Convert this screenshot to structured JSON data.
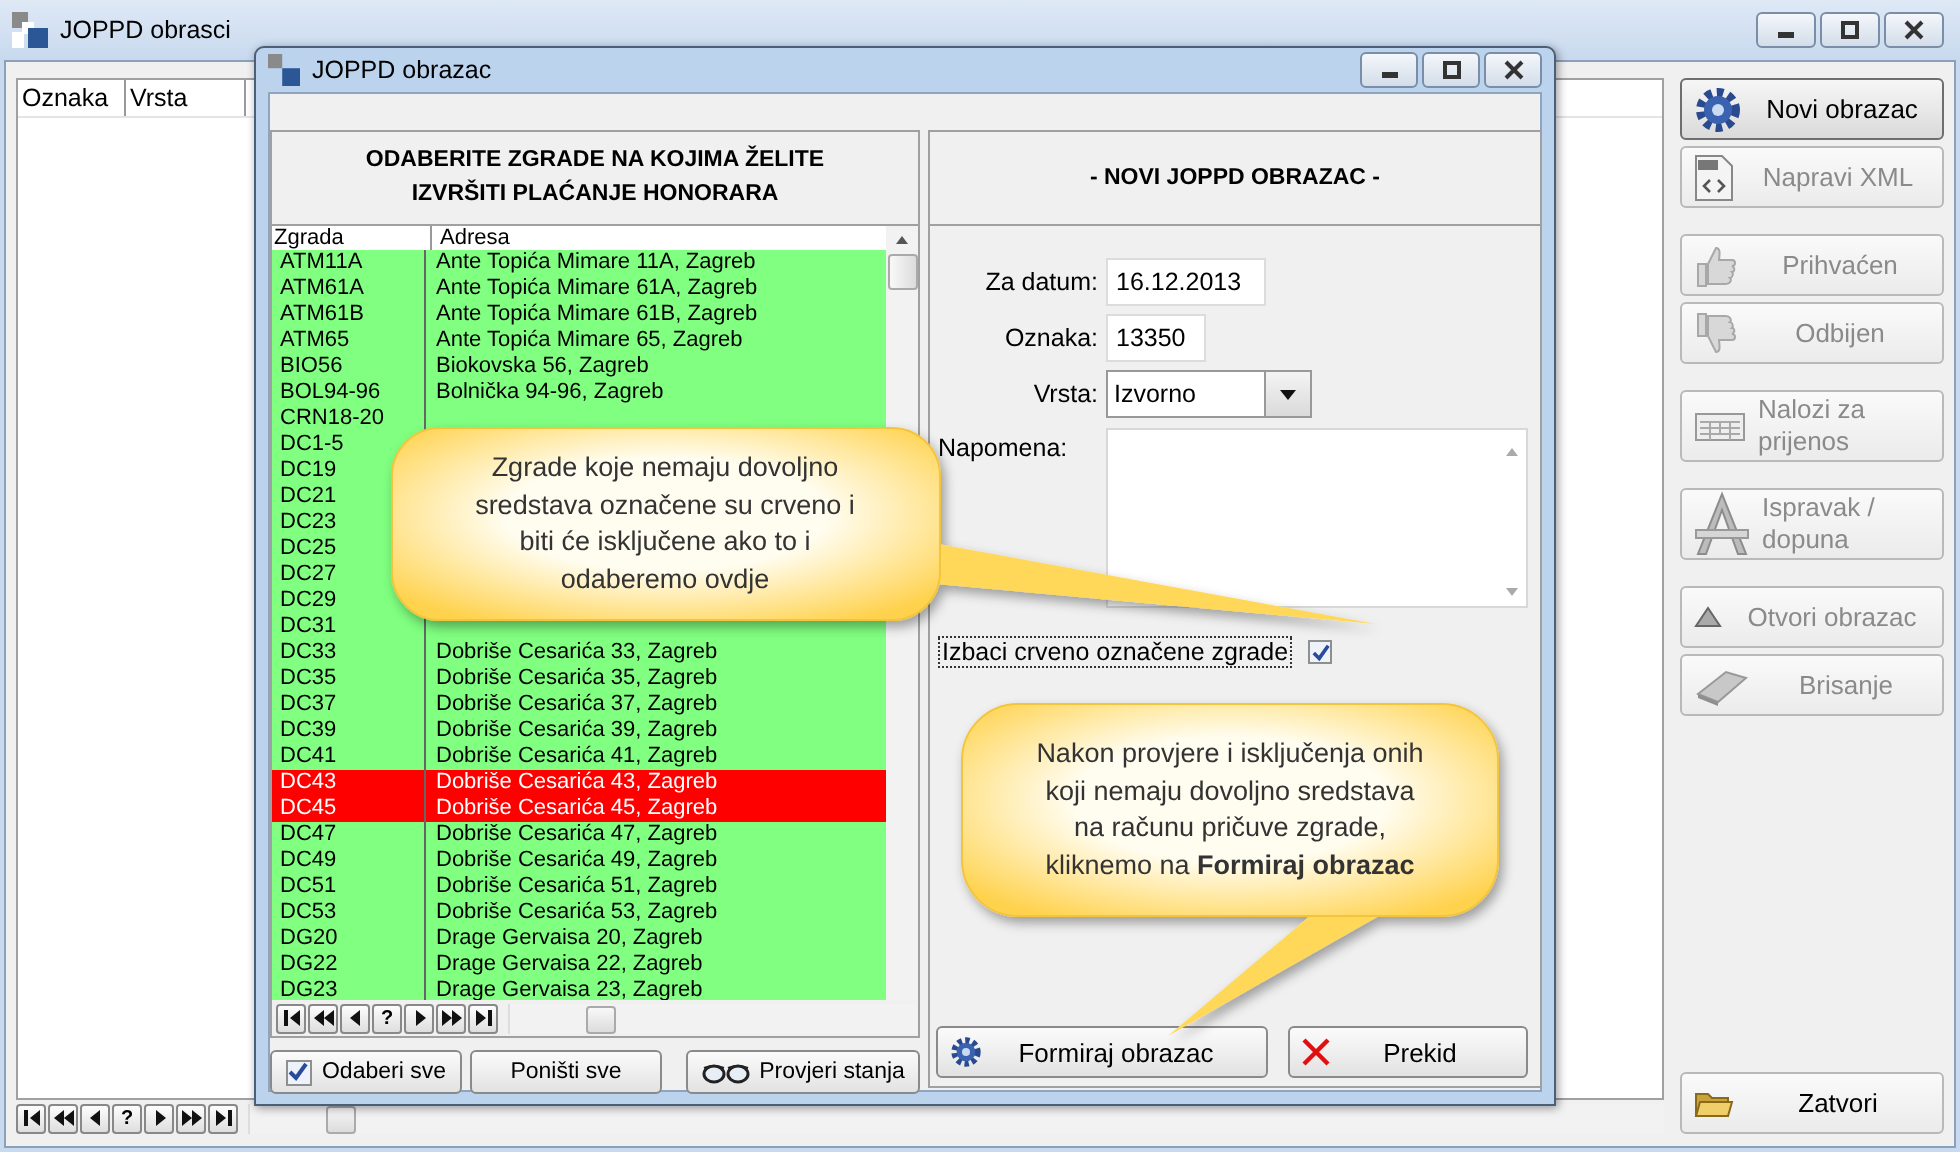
{
  "window": {
    "title": "JOPPD obrasci"
  },
  "main_table": {
    "columns": [
      "Oznaka",
      "Vrsta"
    ]
  },
  "main_navigator": [
    {
      "kind": "first"
    },
    {
      "kind": "prev-page"
    },
    {
      "kind": "prev"
    },
    {
      "kind": "help",
      "label": "?"
    },
    {
      "kind": "next"
    },
    {
      "kind": "next-page"
    },
    {
      "kind": "last"
    }
  ],
  "sidebar": {
    "groups": [
      [
        {
          "kind": "new",
          "label": "Novi obrazac",
          "disabled": false
        },
        {
          "kind": "xml",
          "label": "Napravi XML",
          "disabled": true
        }
      ],
      [
        {
          "kind": "accept",
          "label": "Prihvaćen",
          "disabled": true
        },
        {
          "kind": "reject",
          "label": "Odbijen",
          "disabled": true
        }
      ],
      [
        {
          "kind": "transfer",
          "label": "Nalozi za prijenos",
          "disabled": true
        }
      ],
      [
        {
          "kind": "correction",
          "label": "Ispravak / dopuna",
          "disabled": true
        }
      ],
      [
        {
          "kind": "open",
          "label": "Otvori obrazac",
          "disabled": true
        },
        {
          "kind": "delete",
          "label": "Brisanje",
          "disabled": true
        }
      ]
    ],
    "close_button": {
      "kind": "close",
      "label": "Zatvori",
      "disabled": false
    }
  },
  "dialog": {
    "title": "JOPPD obrazac",
    "buildings_heading": "ODABERITE ZGRADE NA KOJIMA ŽELITE IZVRŠITI PLAĆANJE HONORARA",
    "buildings_table": {
      "columns": [
        "Zgrada",
        "Adresa"
      ],
      "rows": [
        {
          "code": "ATM11A",
          "address": "Ante Topića Mimare 11A, Zagreb",
          "flagged": false
        },
        {
          "code": "ATM61A",
          "address": "Ante Topića Mimare 61A, Zagreb",
          "flagged": false
        },
        {
          "code": "ATM61B",
          "address": "Ante Topića Mimare 61B, Zagreb",
          "flagged": false
        },
        {
          "code": "ATM65",
          "address": "Ante Topića Mimare 65, Zagreb",
          "flagged": false
        },
        {
          "code": "BIO56",
          "address": "Biokovska 56, Zagreb",
          "flagged": false
        },
        {
          "code": "BOL94-96",
          "address": "Bolnička 94-96, Zagreb",
          "flagged": false
        },
        {
          "code": "CRN18-20",
          "flagged": false
        },
        {
          "code": "DC1-5",
          "flagged": false
        },
        {
          "code": "DC19",
          "flagged": false
        },
        {
          "code": "DC21",
          "flagged": false
        },
        {
          "code": "DC23",
          "flagged": false
        },
        {
          "code": "DC25",
          "flagged": false
        },
        {
          "code": "DC27",
          "flagged": false
        },
        {
          "code": "DC29",
          "flagged": false
        },
        {
          "code": "DC31",
          "flagged": false
        },
        {
          "code": "DC33",
          "address": "Dobriše Cesarića 33, Zagreb",
          "flagged": false
        },
        {
          "code": "DC35",
          "address": "Dobriše Cesarića 35, Zagreb",
          "flagged": false
        },
        {
          "code": "DC37",
          "address": "Dobriše Cesarića 37, Zagreb",
          "flagged": false
        },
        {
          "code": "DC39",
          "address": "Dobriše Cesarića 39, Zagreb",
          "flagged": false
        },
        {
          "code": "DC41",
          "address": "Dobriše Cesarića 41, Zagreb",
          "flagged": false
        },
        {
          "code": "DC43",
          "address": "Dobriše Cesarića 43, Zagreb",
          "flagged": true
        },
        {
          "code": "DC45",
          "address": "Dobriše Cesarića 45, Zagreb",
          "flagged": true
        },
        {
          "code": "DC47",
          "address": "Dobriše Cesarića 47, Zagreb",
          "flagged": false
        },
        {
          "code": "DC49",
          "address": "Dobriše Cesarića 49, Zagreb",
          "flagged": false
        },
        {
          "code": "DC51",
          "address": "Dobriše Cesarića 51, Zagreb",
          "flagged": false
        },
        {
          "code": "DC53",
          "address": "Dobriše Cesarića 53, Zagreb",
          "flagged": false
        },
        {
          "code": "DG20",
          "address": "Drage Gervaisa 20, Zagreb",
          "flagged": false
        },
        {
          "code": "DG22",
          "address": "Drage Gervaisa 22, Zagreb",
          "flagged": false
        },
        {
          "code": "DG23",
          "address": "Drage Gervaisa 23, Zagreb",
          "flagged": false
        }
      ]
    },
    "navigator": [
      {
        "kind": "first"
      },
      {
        "kind": "prev-page"
      },
      {
        "kind": "prev"
      },
      {
        "kind": "help",
        "label": "?"
      },
      {
        "kind": "next"
      },
      {
        "kind": "next-page"
      },
      {
        "kind": "last"
      }
    ],
    "select_all": {
      "label": "Odaberi sve",
      "checked": true
    },
    "deselect_all": {
      "label": "Poništi sve"
    },
    "check_balances": {
      "label": "Provjeri stanja"
    },
    "form_heading": "- NOVI JOPPD OBRAZAC -",
    "date": {
      "label": "Za datum:",
      "value": "16.12.2013"
    },
    "code": {
      "label": "Oznaka:",
      "value": "13350"
    },
    "type": {
      "label": "Vrsta:",
      "value": "Izvorno"
    },
    "note": {
      "label": "Napomena:"
    },
    "exclude_flagged": {
      "label": "Izbaci crveno označene zgrade",
      "checked": true
    },
    "create_button": {
      "label": "Formiraj obrazac"
    },
    "cancel_button": {
      "label": "Prekid"
    }
  },
  "callouts": [
    "Zgrade koje nemaju dovoljno sredstava označene su crveno i biti će isključene ako to i odaberemo ovdje",
    "Nakon provjere i isključenja onih koji nemaju dovoljno sredstava na računu pričuve zgrade, kliknemo na **Formiraj obrazac**"
  ]
}
